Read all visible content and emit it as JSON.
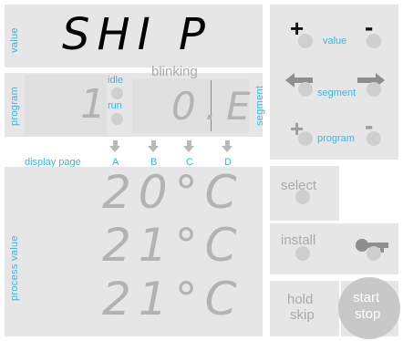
{
  "labels": {
    "value": "value",
    "program": "program",
    "segment": "segment",
    "process_value": "process value",
    "display_page": "display page",
    "idle": "idle",
    "run": "run",
    "blinking": "blinking"
  },
  "displays": {
    "main": "SHI P",
    "program_number": "1",
    "segment": "0.E",
    "pages": [
      "A",
      "B",
      "C",
      "D"
    ],
    "process_rows": [
      "20°C",
      "21°C",
      "21°C"
    ]
  },
  "buttons": {
    "value_plus": "+",
    "value_minus": "-",
    "value_label": "value",
    "segment_label": "segment",
    "program_plus": "+",
    "program_minus": "-",
    "program_label": "program",
    "select": "select",
    "install": "install",
    "hold_line1": "hold",
    "hold_line2": "skip",
    "start_line1": "start",
    "start_line2": "stop"
  },
  "colors": {
    "panel": "#e6e6e6",
    "accent": "#3ab5e6",
    "segment_dark": "#000000",
    "segment_gray": "#b3b3b3",
    "start_stop_bg": "#c8c8c8"
  }
}
